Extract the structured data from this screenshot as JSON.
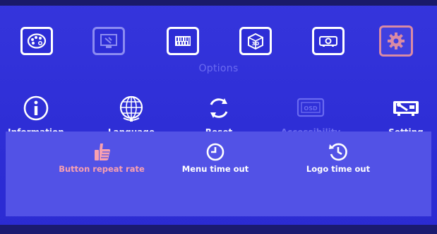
{
  "top_tabs": [
    {
      "icon": "palette-icon",
      "state": "normal"
    },
    {
      "icon": "monitor-tools-icon",
      "state": "dim"
    },
    {
      "icon": "barcode-icon",
      "state": "normal"
    },
    {
      "icon": "3d-cube-icon",
      "state": "normal"
    },
    {
      "icon": "projector-icon",
      "state": "normal"
    },
    {
      "icon": "gear-icon",
      "state": "active"
    }
  ],
  "section_title": "Options",
  "menu_items": [
    {
      "label": "Information",
      "icon": "info-icon",
      "enabled": true
    },
    {
      "label": "Language",
      "icon": "globe-icon",
      "enabled": true
    },
    {
      "label": "Reset",
      "icon": "reset-icon",
      "enabled": true
    },
    {
      "label": "Accessibility",
      "icon": "osd-icon",
      "enabled": false
    },
    {
      "label": "Setting",
      "icon": "setting-icon",
      "enabled": true
    }
  ],
  "osd_badge": "OSD",
  "submenu": [
    {
      "label": "Button repeat rate",
      "icon": "thumbs-up-icon",
      "selected": true
    },
    {
      "label": "Menu time out",
      "icon": "clock-icon",
      "selected": false
    },
    {
      "label": "Logo time out",
      "icon": "clock-reverse-icon",
      "selected": false
    }
  ],
  "colors": {
    "background": "#2f2fd8",
    "panel": "#5252e6",
    "selected_text": "#f8a0b0",
    "disabled_text": "#6a6af0",
    "active_tab_border": "#d98aa4"
  }
}
